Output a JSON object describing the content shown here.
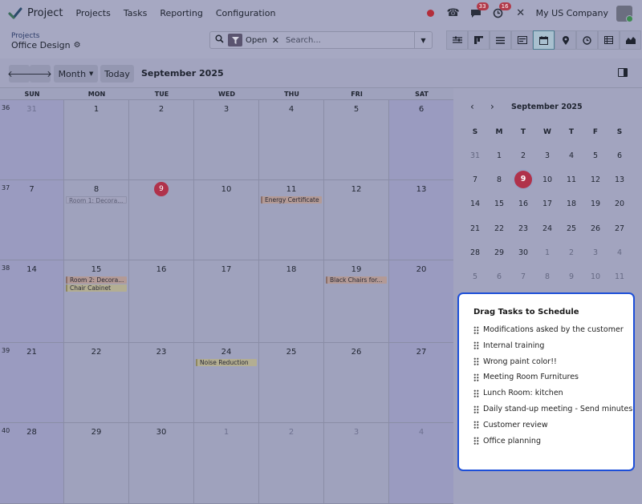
{
  "navbar": {
    "app_name": "Project",
    "menu": [
      "Projects",
      "Tasks",
      "Reporting",
      "Configuration"
    ],
    "messages_badge": "33",
    "activities_badge": "16",
    "company": "My US Company"
  },
  "breadcrumb": {
    "parent": "Projects",
    "current": "Office Design"
  },
  "search": {
    "facet": "Open",
    "placeholder": "Search..."
  },
  "toolbar": {
    "scale": "Month",
    "today": "Today",
    "title": "September 2025"
  },
  "weekdays": [
    "SUN",
    "MON",
    "TUE",
    "WED",
    "THU",
    "FRI",
    "SAT"
  ],
  "weeks": [
    {
      "num": "36",
      "days": [
        "31",
        "1",
        "2",
        "3",
        "4",
        "5",
        "6"
      ]
    },
    {
      "num": "37",
      "days": [
        "7",
        "8",
        "9",
        "10",
        "11",
        "12",
        "13"
      ]
    },
    {
      "num": "38",
      "days": [
        "14",
        "15",
        "16",
        "17",
        "18",
        "19",
        "20"
      ]
    },
    {
      "num": "39",
      "days": [
        "21",
        "22",
        "23",
        "24",
        "25",
        "26",
        "27"
      ]
    },
    {
      "num": "40",
      "days": [
        "28",
        "29",
        "30",
        "1",
        "2",
        "3",
        "4"
      ]
    }
  ],
  "events": [
    {
      "week": 1,
      "day": 1,
      "slot": 0,
      "label": "Room 1: Decora...",
      "style": "ghost"
    },
    {
      "week": 1,
      "day": 4,
      "slot": 0,
      "label": "Energy Certificate",
      "style": "orange"
    },
    {
      "week": 2,
      "day": 1,
      "slot": 0,
      "label": "Room 2: Decora...",
      "style": "orange"
    },
    {
      "week": 2,
      "day": 1,
      "slot": 1,
      "label": "Chair Cabinet",
      "style": "yellow"
    },
    {
      "week": 2,
      "day": 5,
      "slot": 0,
      "label": "Black Chairs for...",
      "style": "orange"
    },
    {
      "week": 3,
      "day": 3,
      "slot": 0,
      "label": "Noise Reduction",
      "style": "yellow"
    }
  ],
  "mini_calendar": {
    "title": "September 2025",
    "weekdays": [
      "S",
      "M",
      "T",
      "W",
      "T",
      "F",
      "S"
    ],
    "weeks": [
      [
        "31",
        "1",
        "2",
        "3",
        "4",
        "5",
        "6"
      ],
      [
        "7",
        "8",
        "9",
        "10",
        "11",
        "12",
        "13"
      ],
      [
        "14",
        "15",
        "16",
        "17",
        "18",
        "19",
        "20"
      ],
      [
        "21",
        "22",
        "23",
        "24",
        "25",
        "26",
        "27"
      ],
      [
        "28",
        "29",
        "30",
        "1",
        "2",
        "3",
        "4"
      ],
      [
        "5",
        "6",
        "7",
        "8",
        "9",
        "10",
        "11"
      ]
    ]
  },
  "drag_panel": {
    "title": "Drag Tasks to Schedule",
    "items": [
      "Modifications asked by the customer",
      "Internal training",
      "Wrong paint color!!",
      "Meeting Room Furnitures",
      "Lunch Room: kitchen",
      "Daily stand-up meeting - Send minutes",
      "Customer review",
      "Office planning"
    ]
  },
  "colors": {
    "today": "#b0324b",
    "accent": "#1d4fd8"
  }
}
